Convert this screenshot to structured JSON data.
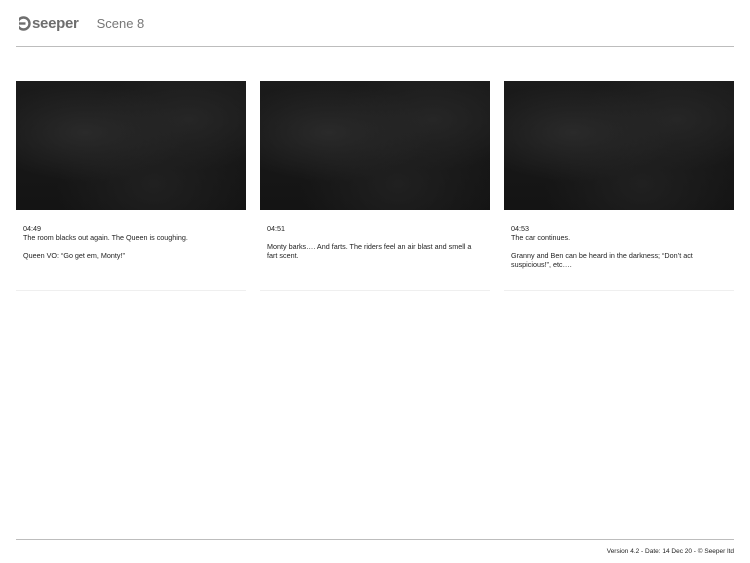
{
  "header": {
    "logo_text": "seeper",
    "scene_title": "Scene 8"
  },
  "frames": [
    {
      "time": "04:49",
      "line1": "The room blacks out again. The Queen is coughing.",
      "line2": "Queen VO: “Go get em, Monty!”"
    },
    {
      "time": "04:51",
      "line1": "Monty barks…. And farts. The riders feel an air blast and smell a fart scent.",
      "line2": ""
    },
    {
      "time": "04:53",
      "line1": "The car continues.",
      "line2": "Granny and Ben can be heard in the darkness; “Don’t act suspicious!”, etc…."
    }
  ],
  "footer": {
    "text": "Version 4.2 - Date: 14 Dec 20 - © Seeper ltd"
  }
}
